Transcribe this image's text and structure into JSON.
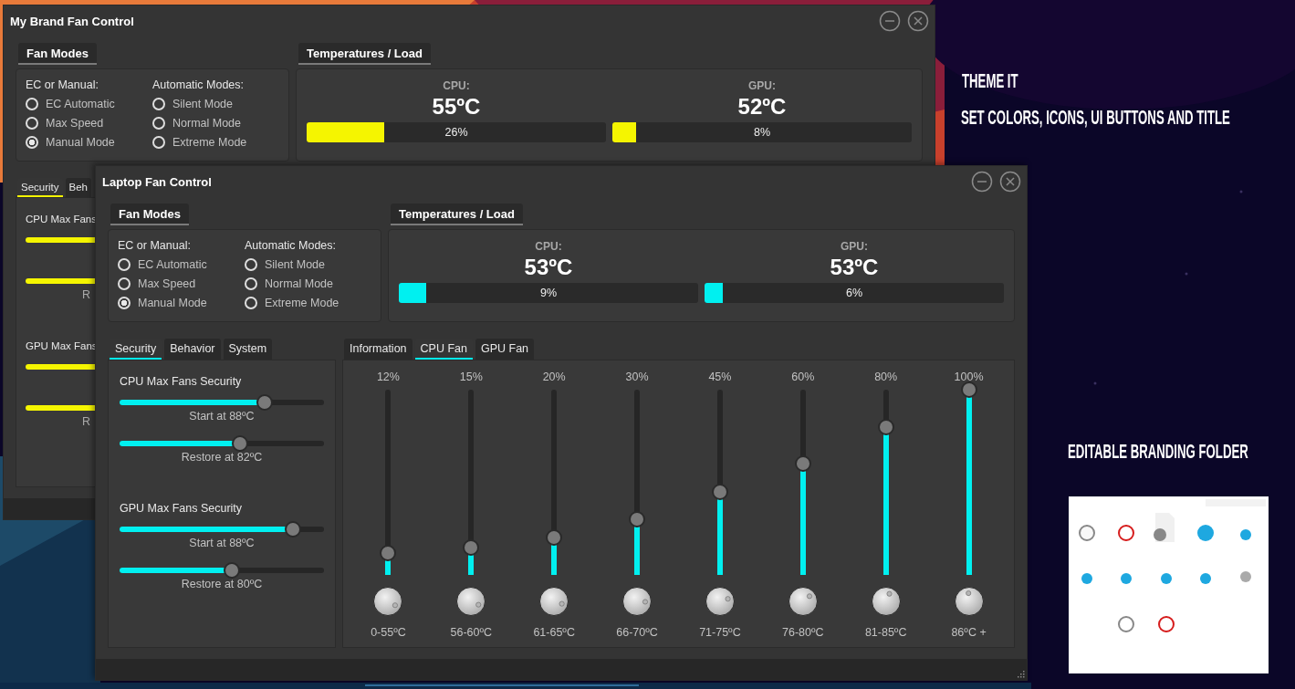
{
  "windows": [
    {
      "title": "My Brand Fan Control",
      "fan_modes": {
        "title": "Fan Modes",
        "groups": [
          {
            "label": "EC or Manual:",
            "options": [
              {
                "label": "EC Automatic",
                "selected": false
              },
              {
                "label": "Max Speed",
                "selected": false
              },
              {
                "label": "Manual Mode",
                "selected": true
              }
            ]
          },
          {
            "label": "Automatic Modes:",
            "options": [
              {
                "label": "Silent Mode",
                "selected": false
              },
              {
                "label": "Normal Mode",
                "selected": false
              },
              {
                "label": "Extreme Mode",
                "selected": false
              }
            ]
          }
        ]
      },
      "temperatures": {
        "title": "Temperatures / Load",
        "sensors": [
          {
            "name": "CPU:",
            "temp": "55ºC",
            "level": 0.26,
            "load": "26%"
          },
          {
            "name": "GPU:",
            "temp": "52ºC",
            "level": 0.08,
            "load": "8%"
          }
        ]
      },
      "left_tabs": [
        {
          "label": "Security",
          "selected": true
        },
        {
          "label": "Beh",
          "selected": false
        }
      ],
      "security": [
        {
          "title": "CPU Max Fans",
          "sliders": [
            {
              "kind": "bar"
            },
            {
              "kind": "bar",
              "label": "R"
            }
          ]
        },
        {
          "title": "GPU Max Fans",
          "sliders": [
            {
              "kind": "bar"
            },
            {
              "kind": "bar",
              "label": "R"
            }
          ]
        }
      ]
    },
    {
      "title": "Laptop Fan Control",
      "fan_modes": {
        "title": "Fan Modes",
        "groups": [
          {
            "label": "EC or Manual:",
            "options": [
              {
                "label": "EC Automatic",
                "selected": false
              },
              {
                "label": "Max Speed",
                "selected": false
              },
              {
                "label": "Manual Mode",
                "selected": true
              }
            ]
          },
          {
            "label": "Automatic Modes:",
            "options": [
              {
                "label": "Silent Mode",
                "selected": false
              },
              {
                "label": "Normal Mode",
                "selected": false
              },
              {
                "label": "Extreme Mode",
                "selected": false
              }
            ]
          }
        ]
      },
      "temperatures": {
        "title": "Temperatures / Load",
        "sensors": [
          {
            "name": "CPU:",
            "temp": "53ºC",
            "level": 0.09,
            "load": "9%"
          },
          {
            "name": "GPU:",
            "temp": "53ºC",
            "level": 0.06,
            "load": "6%"
          }
        ]
      },
      "left_tabs": [
        {
          "label": "Security",
          "selected": true
        },
        {
          "label": "Behavior",
          "selected": false
        },
        {
          "label": "System",
          "selected": false
        }
      ],
      "security": [
        {
          "title": "CPU Max Fans Security",
          "sliders": [
            {
              "kind": "slider",
              "label": "Start at 88ºC",
              "level": 0.71
            },
            {
              "kind": "slider",
              "label": "Restore at 82ºC",
              "level": 0.59
            }
          ]
        },
        {
          "title": "GPU Max Fans Security",
          "sliders": [
            {
              "kind": "slider",
              "label": "Start at 88ºC",
              "level": 0.85
            },
            {
              "kind": "slider",
              "label": "Restore at 80ºC",
              "level": 0.55
            }
          ]
        }
      ],
      "right_tabs": [
        {
          "label": "Information",
          "selected": false
        },
        {
          "label": "CPU Fan",
          "selected": true
        },
        {
          "label": "GPU Fan",
          "selected": false
        }
      ],
      "fan_curve": [
        {
          "percent": "12%",
          "level": 0.12,
          "range": "0-55ºC"
        },
        {
          "percent": "15%",
          "level": 0.15,
          "range": "56-60ºC"
        },
        {
          "percent": "20%",
          "level": 0.2,
          "range": "61-65ºC"
        },
        {
          "percent": "30%",
          "level": 0.3,
          "range": "66-70ºC"
        },
        {
          "percent": "45%",
          "level": 0.45,
          "range": "71-75ºC"
        },
        {
          "percent": "60%",
          "level": 0.6,
          "range": "76-80ºC"
        },
        {
          "percent": "80%",
          "level": 0.8,
          "range": "81-85ºC"
        },
        {
          "percent": "100%",
          "level": 1,
          "range": "86ºC +"
        }
      ]
    }
  ],
  "promo": [
    {
      "text": "THEME IT"
    },
    {
      "text": "SET COLORS, ICONS, UI BUTTONS AND TITLE"
    },
    {
      "text": "EDITABLE BRANDING FOLDER"
    }
  ]
}
